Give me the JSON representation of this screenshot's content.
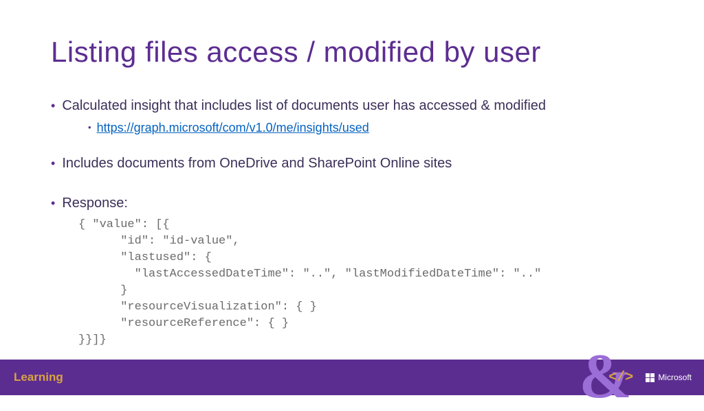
{
  "title": "Listing files access / modified by user",
  "bullets": {
    "b1": "Calculated insight that includes list of documents user has accessed & modified",
    "b1_link": "https://graph.microsoft/com/v1.0/me/insights/used",
    "b2": "Includes documents from OneDrive and SharePoint Online sites",
    "b3": "Response:"
  },
  "code": "{ \"value\": [{\n      \"id\": \"id-value\",\n      \"lastused\": {\n        \"lastAccessedDateTime\": \"..\", \"lastModifiedDateTime\": \"..\"\n      }\n      \"resourceVisualization\": { }\n      \"resourceReference\": { }\n}}]}",
  "footer": {
    "learning": "Learning",
    "code_icon": "</>",
    "ms": "Microsoft"
  }
}
